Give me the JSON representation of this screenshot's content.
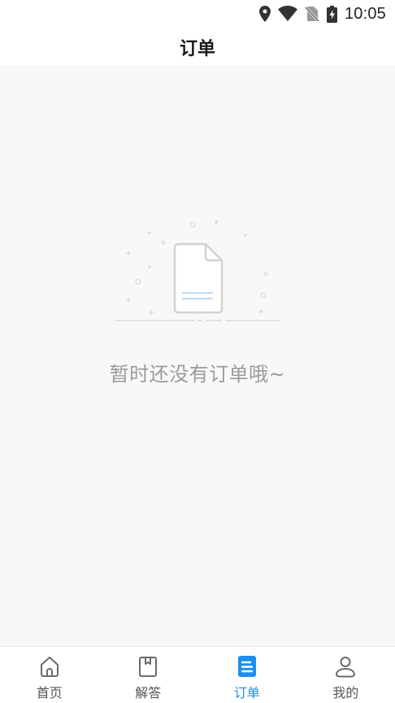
{
  "status_bar": {
    "time": "10:05",
    "icons": [
      "location-icon",
      "wifi-icon",
      "no-sim-icon",
      "battery-charging-icon"
    ]
  },
  "header": {
    "title": "订单"
  },
  "empty_state": {
    "illustration": "empty-document-icon",
    "message": "暂时还没有订单哦~"
  },
  "tabbar": {
    "active_tab": "订单",
    "accent_color": "#1f8ef1",
    "tabs": [
      {
        "label": "首页",
        "icon": "home-icon"
      },
      {
        "label": "解答",
        "icon": "bookmark-icon"
      },
      {
        "label": "订单",
        "icon": "order-document-icon"
      },
      {
        "label": "我的",
        "icon": "user-icon"
      }
    ]
  }
}
